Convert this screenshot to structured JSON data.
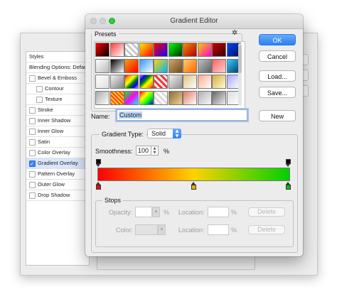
{
  "gradient_editor": {
    "title": "Gradient Editor",
    "presets_label": "Presets",
    "presets_gear_icon": "gear-icon",
    "name_label": "Name:",
    "name_value": "Custom",
    "buttons": {
      "ok": "OK",
      "cancel": "Cancel",
      "load": "Load...",
      "save": "Save...",
      "new": "New"
    },
    "gradient_type_label": "Gradient Type:",
    "gradient_type_value": "Solid",
    "smoothness_label": "Smoothness:",
    "smoothness_value": "100",
    "smoothness_unit": "%",
    "gradient_colors": [
      "#ff0000",
      "#ffd200",
      "#00d000"
    ],
    "stops": {
      "label": "Stops",
      "opacity_label": "Opacity:",
      "opacity_unit": "%",
      "color_label": "Color:",
      "location_label": "Location:",
      "location_unit": "%",
      "delete_label": "Delete"
    }
  },
  "layer_style": {
    "styles_label": "Styles",
    "rows": [
      {
        "label": "Blending Options: Default",
        "checkbox": false
      },
      {
        "label": "Bevel & Emboss",
        "checkbox": true,
        "checked": false
      },
      {
        "label": "Contour",
        "checkbox": true,
        "checked": false,
        "indent": true
      },
      {
        "label": "Texture",
        "checkbox": true,
        "checked": false,
        "indent": true
      },
      {
        "label": "Stroke",
        "checkbox": true,
        "checked": false
      },
      {
        "label": "Inner Shadow",
        "checkbox": true,
        "checked": false
      },
      {
        "label": "Inner Glow",
        "checkbox": true,
        "checked": false
      },
      {
        "label": "Satin",
        "checkbox": true,
        "checked": false
      },
      {
        "label": "Color Overlay",
        "checkbox": true,
        "checked": false
      },
      {
        "label": "Gradient Overlay",
        "checkbox": true,
        "checked": true,
        "selected": true
      },
      {
        "label": "Pattern Overlay",
        "checkbox": true,
        "checked": false
      },
      {
        "label": "Outer Glow",
        "checkbox": true,
        "checked": false
      },
      {
        "label": "Drop Shadow",
        "checkbox": true,
        "checked": false
      }
    ]
  }
}
